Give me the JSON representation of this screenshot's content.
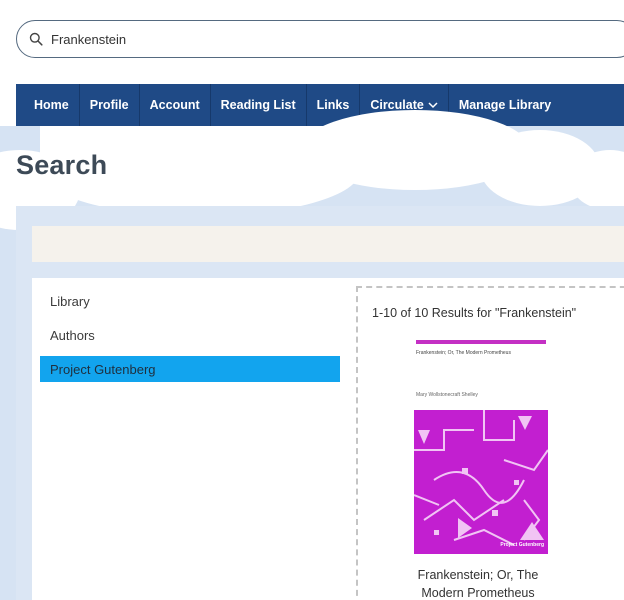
{
  "search": {
    "value": "Frankenstein",
    "placeholder": ""
  },
  "nav": {
    "items": [
      {
        "label": "Home"
      },
      {
        "label": "Profile"
      },
      {
        "label": "Account"
      },
      {
        "label": "Reading List"
      },
      {
        "label": "Links"
      },
      {
        "label": "Circulate"
      },
      {
        "label": "Manage Library"
      }
    ]
  },
  "page": {
    "title": "Search"
  },
  "sidebar": {
    "items": [
      {
        "label": "Library",
        "active": false
      },
      {
        "label": "Authors",
        "active": false
      },
      {
        "label": "Project Gutenberg",
        "active": true
      }
    ]
  },
  "results": {
    "count_text": "1-10 of 10 Results for \"Frankenstein\"",
    "items": [
      {
        "cover_title": "Frankenstein; Or, The Modern Prometheus",
        "cover_author": "Mary Wollstonecraft Shelley",
        "cover_brand": "Project Gutenberg",
        "title_line1": "Frankenstein; Or, The",
        "title_line2": "Modern Prometheus"
      }
    ]
  },
  "colors": {
    "nav_bg": "#1f4a86",
    "active_item": "#12a4ee",
    "cover_accent": "#c430c4"
  }
}
